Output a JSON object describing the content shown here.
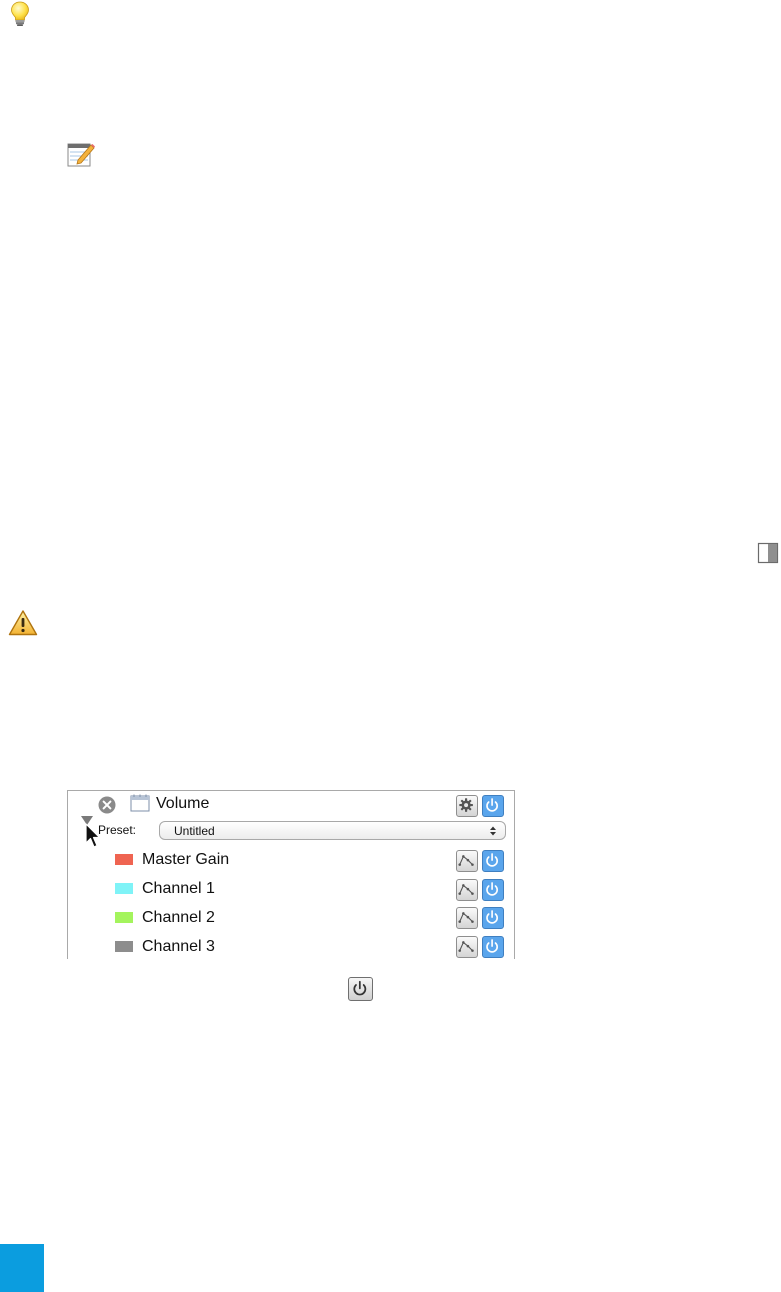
{
  "plugin": {
    "title": "Volume",
    "preset_label": "Preset:",
    "preset_value": "Untitled",
    "channels": [
      {
        "label": "Master Gain",
        "color": "#ef6451"
      },
      {
        "label": "Channel 1",
        "color": "#7ff3f7"
      },
      {
        "label": "Channel 2",
        "color": "#a4f45d"
      },
      {
        "label": "Channel 3",
        "color": "#8d8d8d"
      }
    ]
  },
  "icons": {
    "tip": "lightbulb-icon",
    "note": "notepad-icon",
    "pane": "split-pane-icon",
    "warning": "warning-icon",
    "power": "power-icon",
    "settings": "gear-icon",
    "automation": "automation-curve-icon",
    "remove": "close-circle-icon",
    "plugin": "plugin-window-icon"
  },
  "colors": {
    "power_button": "#5aa5ec",
    "page_marker": "#0b9ddf",
    "warning_fill": "#f7c64a"
  }
}
